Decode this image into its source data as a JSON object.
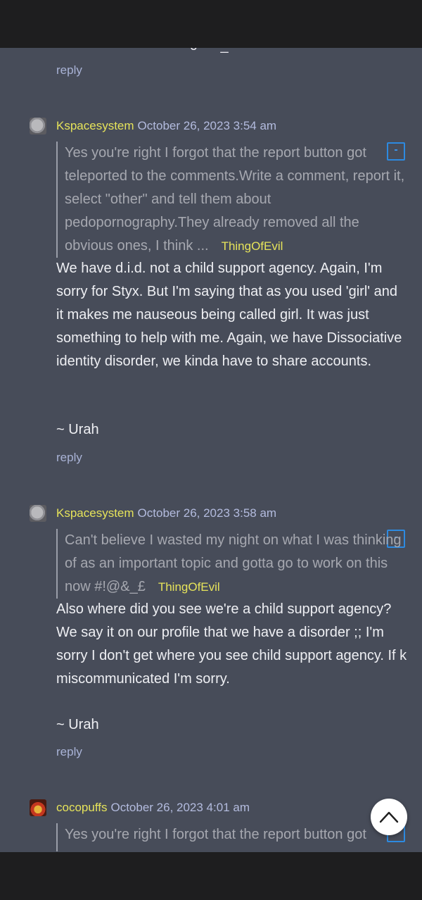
{
  "top_fragment": "ͼ _",
  "prev_reply_label": "reply",
  "comments": [
    {
      "username": "Kspacesystem",
      "date": "October 26, 2023 3:54 am",
      "quote_text": "Yes you're right I forgot that the report button got teleported to the comments.Write a comment, report it, select \"other\" and tell them about pedopornography.They already removed all the obvious ones, I think ...",
      "quote_author": "ThingOfEvil",
      "collapse_label": "-",
      "body": "We have d.i.d. not a child support agency. Again, I'm sorry for Styx. But I'm saying that as you used 'girl' and it makes me nauseous being called girl. It was just something to help with me. Again, we have Dissociative identity disorder, we kinda have to share accounts.",
      "signature": "~ Urah",
      "reply_label": "reply"
    },
    {
      "username": "Kspacesystem",
      "date": "October 26, 2023 3:58 am",
      "quote_text": "Can't believe I wasted my night on what I was thinking of as an important topic and gotta go to work on this now #!@&_£",
      "quote_author": "ThingOfEvil",
      "collapse_label": "-",
      "body": "Also where did you see we're a child support agency? We say it on our profile that we have a disorder ;; I'm sorry I don't get where you see child support agency. If k miscommunicated I'm sorry.",
      "signature": "~ Urah",
      "reply_label": "reply"
    },
    {
      "username": "cocopuffs",
      "date": "October 26, 2023 4:01 am",
      "quote_text": "Yes you're right I forgot that the report button got",
      "collapse_label": "-"
    }
  ],
  "icons": {
    "scroll_top": "chevron-up-icon",
    "avatar": "avatar-image"
  },
  "colors": {
    "background": "#474c59",
    "username": "#e6e35a",
    "date": "#b3bbde",
    "reply": "#a9b3d6",
    "accent": "#2d8ae0"
  }
}
